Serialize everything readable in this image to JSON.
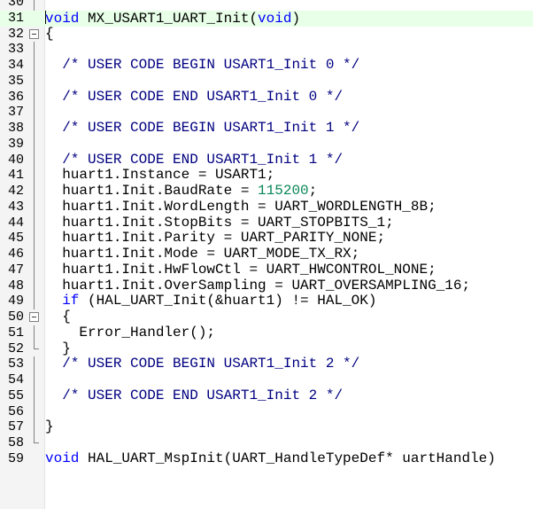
{
  "editor": {
    "current_line": 31,
    "lines": [
      {
        "n": "30",
        "fold": "line",
        "tokens": []
      },
      {
        "n": "31",
        "fold": "none",
        "tokens": [
          {
            "t": "void",
            "c": "kw"
          },
          {
            "t": " MX_USART1_UART_Init(",
            "c": ""
          },
          {
            "t": "void",
            "c": "kw"
          },
          {
            "t": ")",
            "c": ""
          }
        ]
      },
      {
        "n": "32",
        "fold": "box",
        "tokens": [
          {
            "t": "{",
            "c": ""
          }
        ]
      },
      {
        "n": "33",
        "fold": "line",
        "tokens": []
      },
      {
        "n": "34",
        "fold": "line",
        "tokens": [
          {
            "t": "  /* USER CODE BEGIN USART1_Init 0 */",
            "c": "cm"
          }
        ]
      },
      {
        "n": "35",
        "fold": "line",
        "tokens": []
      },
      {
        "n": "36",
        "fold": "line",
        "tokens": [
          {
            "t": "  /* USER CODE END USART1_Init 0 */",
            "c": "cm"
          }
        ]
      },
      {
        "n": "37",
        "fold": "line",
        "tokens": []
      },
      {
        "n": "38",
        "fold": "line",
        "tokens": [
          {
            "t": "  /* USER CODE BEGIN USART1_Init 1 */",
            "c": "cm"
          }
        ]
      },
      {
        "n": "39",
        "fold": "line",
        "tokens": []
      },
      {
        "n": "40",
        "fold": "line",
        "tokens": [
          {
            "t": "  /* USER CODE END USART1_Init 1 */",
            "c": "cm"
          }
        ]
      },
      {
        "n": "41",
        "fold": "line",
        "tokens": [
          {
            "t": "  huart1.Instance = USART1;",
            "c": ""
          }
        ]
      },
      {
        "n": "42",
        "fold": "line",
        "tokens": [
          {
            "t": "  huart1.Init.BaudRate = ",
            "c": ""
          },
          {
            "t": "115200",
            "c": "num-lit"
          },
          {
            "t": ";",
            "c": ""
          }
        ]
      },
      {
        "n": "43",
        "fold": "line",
        "tokens": [
          {
            "t": "  huart1.Init.WordLength = UART_WORDLENGTH_8B;",
            "c": ""
          }
        ]
      },
      {
        "n": "44",
        "fold": "line",
        "tokens": [
          {
            "t": "  huart1.Init.StopBits = UART_STOPBITS_1;",
            "c": ""
          }
        ]
      },
      {
        "n": "45",
        "fold": "line",
        "tokens": [
          {
            "t": "  huart1.Init.Parity = UART_PARITY_NONE;",
            "c": ""
          }
        ]
      },
      {
        "n": "46",
        "fold": "line",
        "tokens": [
          {
            "t": "  huart1.Init.Mode = UART_MODE_TX_RX;",
            "c": ""
          }
        ]
      },
      {
        "n": "47",
        "fold": "line",
        "tokens": [
          {
            "t": "  huart1.Init.HwFlowCtl = UART_HWCONTROL_NONE;",
            "c": ""
          }
        ]
      },
      {
        "n": "48",
        "fold": "line",
        "tokens": [
          {
            "t": "  huart1.Init.OverSampling = UART_OVERSAMPLING_16;",
            "c": ""
          }
        ]
      },
      {
        "n": "49",
        "fold": "line",
        "tokens": [
          {
            "t": "  ",
            "c": ""
          },
          {
            "t": "if",
            "c": "kw"
          },
          {
            "t": " (HAL_UART_Init(&huart1) != HAL_OK)",
            "c": ""
          }
        ]
      },
      {
        "n": "50",
        "fold": "box",
        "tokens": [
          {
            "t": "  {",
            "c": ""
          }
        ]
      },
      {
        "n": "51",
        "fold": "line",
        "tokens": [
          {
            "t": "    Error_Handler();",
            "c": ""
          }
        ]
      },
      {
        "n": "52",
        "fold": "end",
        "tokens": [
          {
            "t": "  }",
            "c": ""
          }
        ]
      },
      {
        "n": "53",
        "fold": "line",
        "tokens": [
          {
            "t": "  /* USER CODE BEGIN USART1_Init 2 */",
            "c": "cm"
          }
        ]
      },
      {
        "n": "54",
        "fold": "line",
        "tokens": []
      },
      {
        "n": "55",
        "fold": "line",
        "tokens": [
          {
            "t": "  /* USER CODE END USART1_Init 2 */",
            "c": "cm"
          }
        ]
      },
      {
        "n": "56",
        "fold": "line",
        "tokens": []
      },
      {
        "n": "57",
        "fold": "line",
        "tokens": [
          {
            "t": "}",
            "c": ""
          }
        ]
      },
      {
        "n": "58",
        "fold": "end",
        "tokens": []
      },
      {
        "n": "59",
        "fold": "none",
        "tokens": [
          {
            "t": "void",
            "c": "kw"
          },
          {
            "t": " HAL_UART_MspInit(UART_HandleTypeDef* uartHandle)",
            "c": ""
          }
        ]
      }
    ]
  }
}
